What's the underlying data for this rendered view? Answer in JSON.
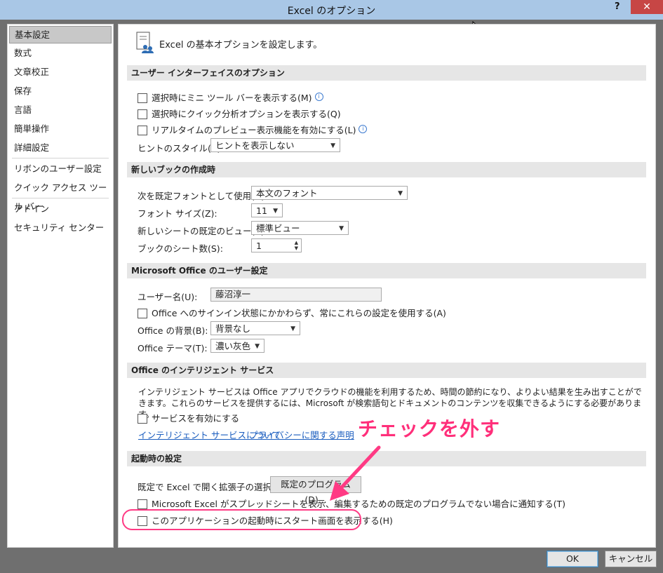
{
  "window": {
    "title": "Excel のオプション",
    "help": "?",
    "close": "✕"
  },
  "nav": {
    "group1": [
      "基本設定",
      "数式",
      "文章校正",
      "保存",
      "言語",
      "簡単操作",
      "詳細設定"
    ],
    "group2": [
      "リボンのユーザー設定",
      "クイック アクセス ツール バー"
    ],
    "group3": [
      "アドイン",
      "セキュリティ センター"
    ]
  },
  "intro": "Excel の基本オプションを設定します。",
  "ui_section": {
    "title": "ユーザー インターフェイスのオプション",
    "mini_toolbar": "選択時にミニ ツール バーを表示する(M)",
    "quick_analysis": "選択時にクイック分析オプションを表示する(Q)",
    "live_preview": "リアルタイムのプレビュー表示機能を有効にする(L)",
    "tooltip_label": "ヒントのスタイル(R):",
    "tooltip_value": "ヒントを表示しない"
  },
  "new_book": {
    "title": "新しいブックの作成時",
    "font_label": "次を既定フォントとして使用(N):",
    "font_value": "本文のフォント",
    "size_label": "フォント サイズ(Z):",
    "size_value": "11",
    "view_label": "新しいシートの既定のビュー(V):",
    "view_value": "標準ビュー",
    "sheets_label": "ブックのシート数(S):",
    "sheets_value": "1"
  },
  "user": {
    "title": "Microsoft Office のユーザー設定",
    "name_label": "ユーザー名(U):",
    "name_value": "藤沼淳一",
    "always_use": "Office へのサインイン状態にかかわらず、常にこれらの設定を使用する(A)",
    "background_label": "Office の背景(B):",
    "background_value": "背景なし",
    "theme_label": "Office テーマ(T):",
    "theme_value": "濃い灰色"
  },
  "intelligent": {
    "title": "Office のインテリジェント サービス",
    "description": "インテリジェント サービスは Office アプリでクラウドの機能を利用するため、時間の節約になり、よりよい結果を生み出すことができます。これらのサービスを提供するには、Microsoft が検索語句とドキュメントのコンテンツを収集できるようにする必要があります。",
    "enable": "サービスを有効にする",
    "about_link": "インテリジェント サービスについて",
    "privacy_link": "プライバシーに関する声明"
  },
  "startup": {
    "title": "起動時の設定",
    "extensions_label": "既定で Excel で開く拡張子の選択:",
    "default_programs_button": "既定のプログラム(D)...",
    "notify": "Microsoft Excel がスプレッドシートを表示、編集するための既定のプログラムでない場合に通知する(T)",
    "show_start": "このアプリケーションの起動時にスタート画面を表示する(H)"
  },
  "annotation": "チェックを外す",
  "footer": {
    "ok": "OK",
    "cancel": "キャンセル"
  },
  "colors": {
    "annotation": "#ff2f7a",
    "titlebar": "#a9c7e6",
    "close": "#c74645"
  }
}
